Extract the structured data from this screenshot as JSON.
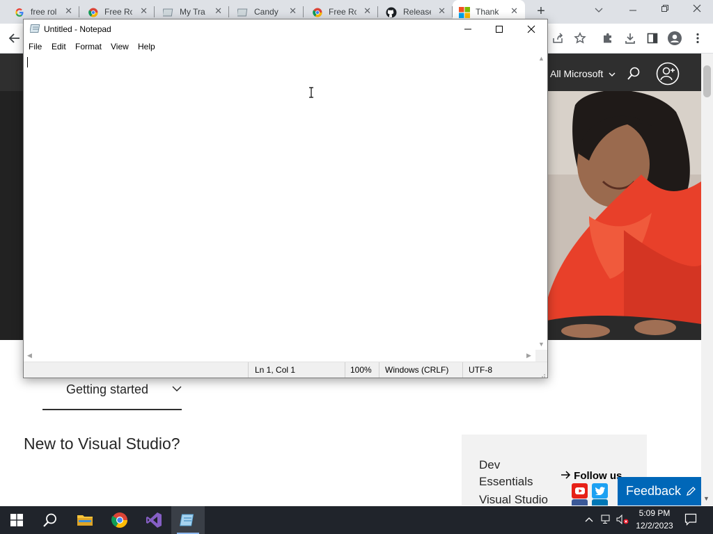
{
  "browser": {
    "tabs": [
      {
        "title": "free rol",
        "favicon": "google-icon"
      },
      {
        "title": "Free Ro",
        "favicon": "chrome-icon"
      },
      {
        "title": "My Tra",
        "favicon": "page-icon"
      },
      {
        "title": "Candy",
        "favicon": "page-icon"
      },
      {
        "title": "Free Ro",
        "favicon": "chrome-icon"
      },
      {
        "title": "Release",
        "favicon": "github-icon"
      },
      {
        "title": "Thank",
        "favicon": "microsoft-icon"
      }
    ],
    "new_tab": "+",
    "close_glyph": "✕"
  },
  "page": {
    "all_microsoft": "All Microsoft",
    "getting_started": "Getting started",
    "new_to_vs": "New to Visual Studio?",
    "dev_links": [
      "Dev",
      "Essentials",
      "Visual Studio"
    ],
    "follow_us": "Follow us",
    "feedback": "Feedback"
  },
  "notepad": {
    "title": "Untitled - Notepad",
    "menu": [
      "File",
      "Edit",
      "Format",
      "View",
      "Help"
    ],
    "status": {
      "position": "Ln 1, Col 1",
      "zoom": "100%",
      "line_ending": "Windows (CRLF)",
      "encoding": "UTF-8"
    }
  },
  "taskbar": {
    "time": "5:09 PM",
    "date": "12/2/2023"
  },
  "colors": {
    "accent_blue": "#0067b8",
    "header_dark": "#2f2f2f",
    "taskbar": "#20242b"
  }
}
